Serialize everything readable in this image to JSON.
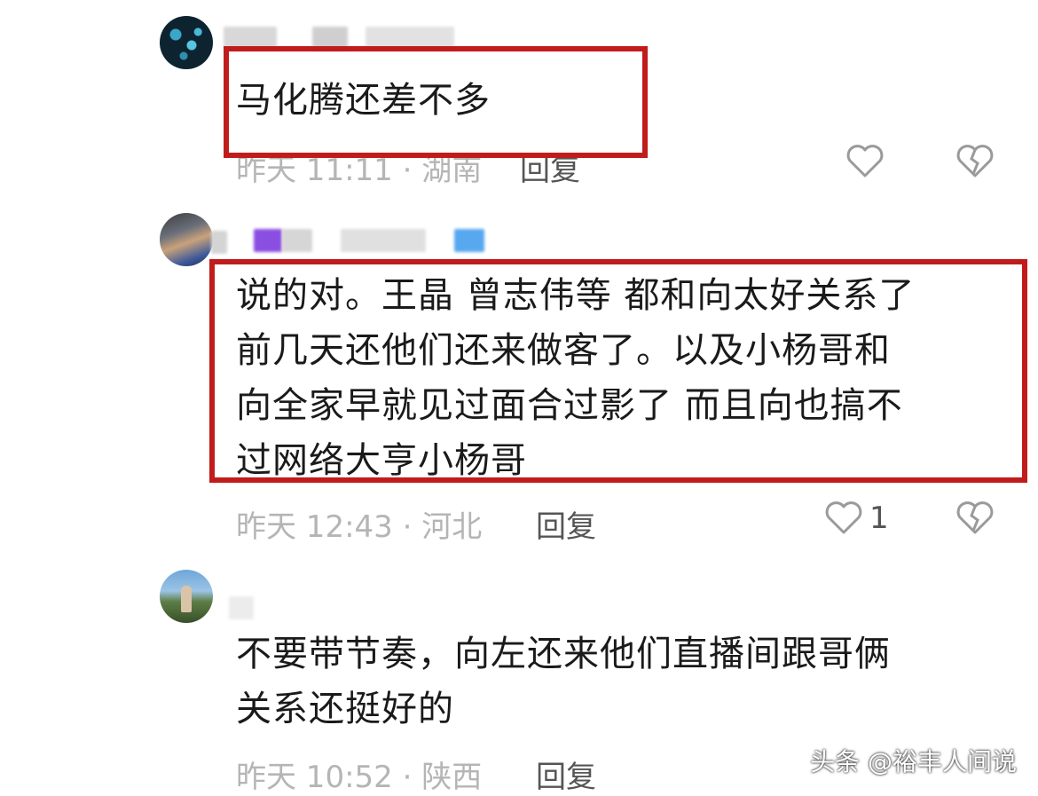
{
  "comments": [
    {
      "text": "马化腾还差不多",
      "time": "昨天 11:11 · 湖南",
      "reply_label": "回复",
      "likes": ""
    },
    {
      "text": "说的对。王晶 曾志伟等 都和向太好关系了\n前几天还他们还来做客了。以及小杨哥和\n向全家早就见过面合过影了 而且向也搞不\n过网络大亨小杨哥",
      "time": "昨天 12:43 · 河北",
      "reply_label": "回复",
      "likes": "1"
    },
    {
      "text": "不要带节奏，向左还来他们直播间跟哥俩\n关系还挺好的",
      "time": "昨天 10:52 · 陕西",
      "reply_label": "回复",
      "likes": ""
    }
  ],
  "watermark": "头条 @裕丰人间说",
  "colors": {
    "highlight": "#c11c1c",
    "meta": "#b5b5b5",
    "text": "#1a1a1a"
  }
}
